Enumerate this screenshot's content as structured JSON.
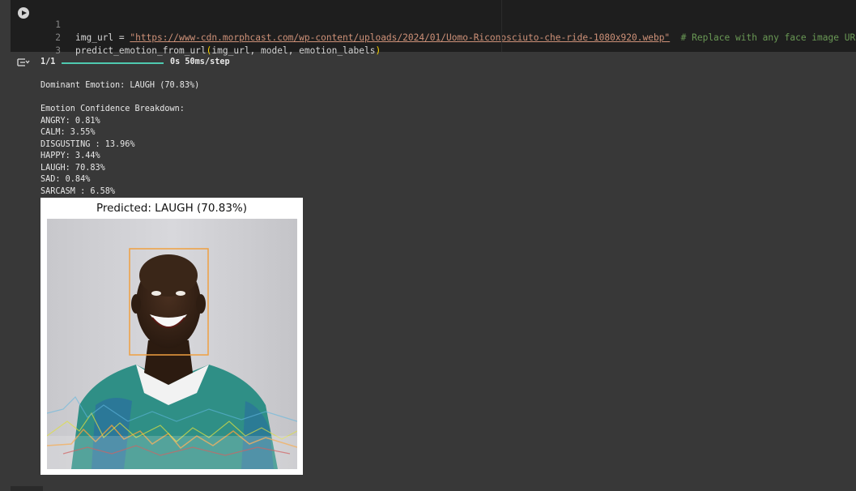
{
  "cell": {
    "run_button_label": "Run cell",
    "lines": [
      {
        "num": "1",
        "prefix": "img_url = ",
        "string": "\"https://www-cdn.morphcast.com/wp-content/uploads/2024/01/Uomo-Riconosciuto-che-ride-1080x920.webp\"",
        "comment": "  # Replace with any face image URL"
      },
      {
        "num": "2",
        "func": "predict_emotion_from_url",
        "open": "(",
        "args": "img_url, model, emotion_labels",
        "close": ")"
      },
      {
        "num": "3"
      }
    ]
  },
  "output": {
    "progress": {
      "step": "1/1",
      "fraction": 1.0,
      "timing": "0s 50ms/step"
    },
    "dominant": "Dominant Emotion: LAUGH (70.83%)",
    "breakdown_header": "Emotion Confidence Breakdown:",
    "breakdown": [
      "ANGRY: 0.81%",
      "CALM: 3.55%",
      "DISGUSTING : 13.96%",
      "HAPPY: 3.44%",
      "LAUGH: 70.83%",
      "SAD: 0.84%",
      "SARCASM : 6.58%"
    ],
    "figure_title": "Predicted: LAUGH (70.83%)"
  },
  "icons": {
    "run": "play-circle-icon",
    "toggle": "output-collapse-icon"
  },
  "colors": {
    "string": "#ce9178",
    "comment": "#6a9955",
    "progress": "#4ec9b0",
    "face_box": "#f0a040"
  }
}
